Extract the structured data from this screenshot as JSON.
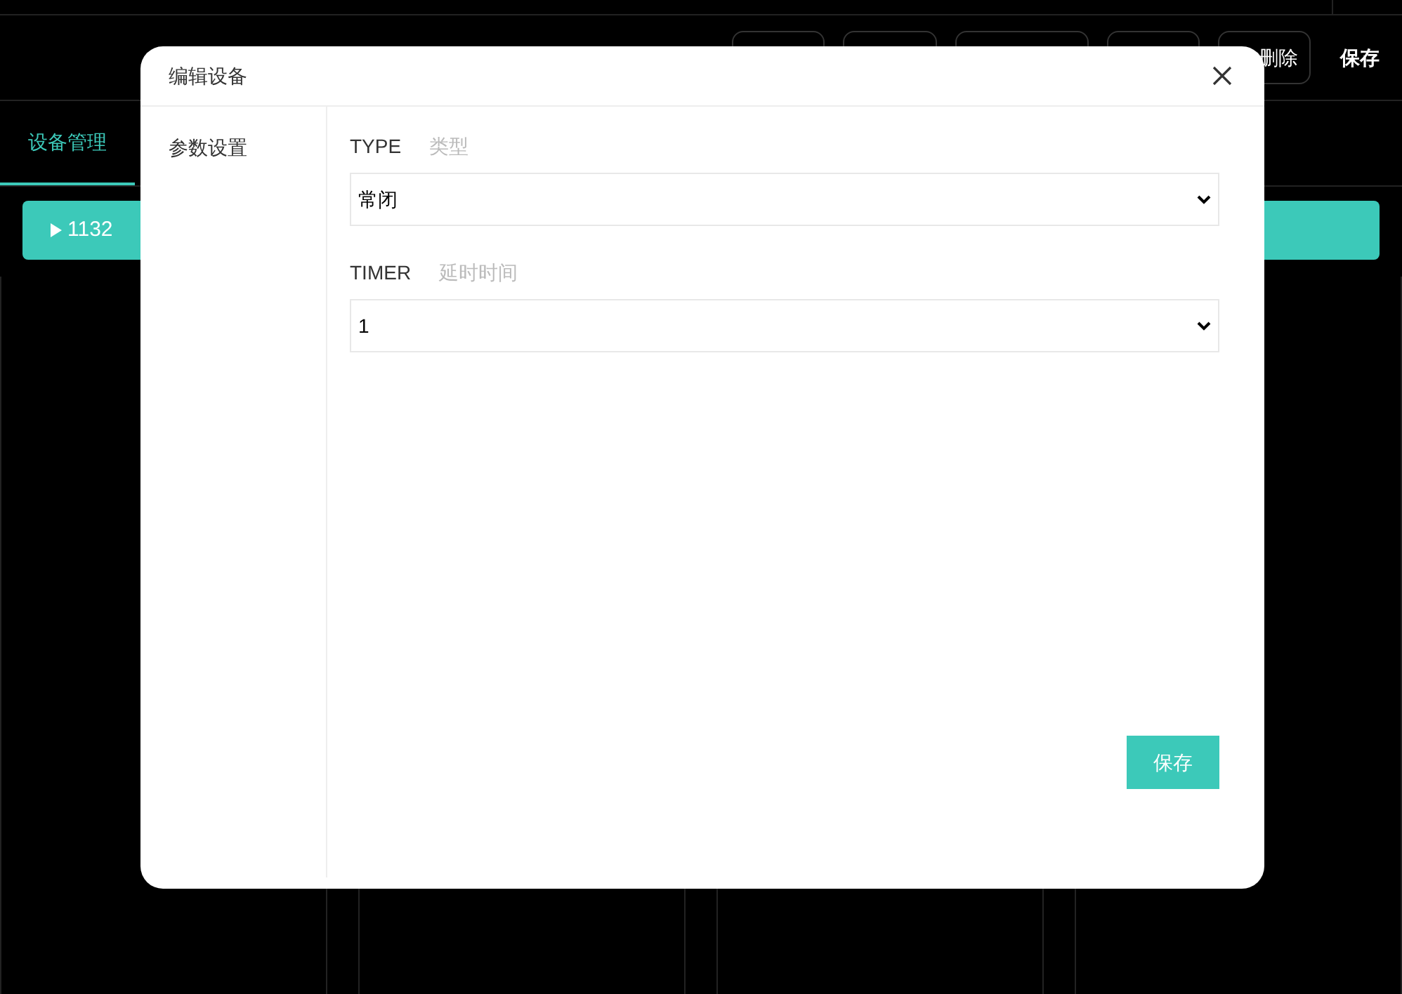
{
  "toolbar": {
    "buttons": [
      {
        "label": "删除"
      },
      {
        "label": "保存"
      }
    ]
  },
  "tabs": [
    {
      "label": "设备管理",
      "selected": true
    }
  ],
  "device_row": {
    "label": "1132",
    "expanded": false
  },
  "dialog": {
    "title": "编辑设备",
    "sidebar": [
      {
        "label": "参数设置",
        "selected": true
      }
    ],
    "fields": [
      {
        "label": "TYPE",
        "hint": "类型",
        "value": "常闭"
      },
      {
        "label": "TIMER",
        "hint": "延时时间",
        "value": "1"
      }
    ],
    "save": "保存"
  }
}
